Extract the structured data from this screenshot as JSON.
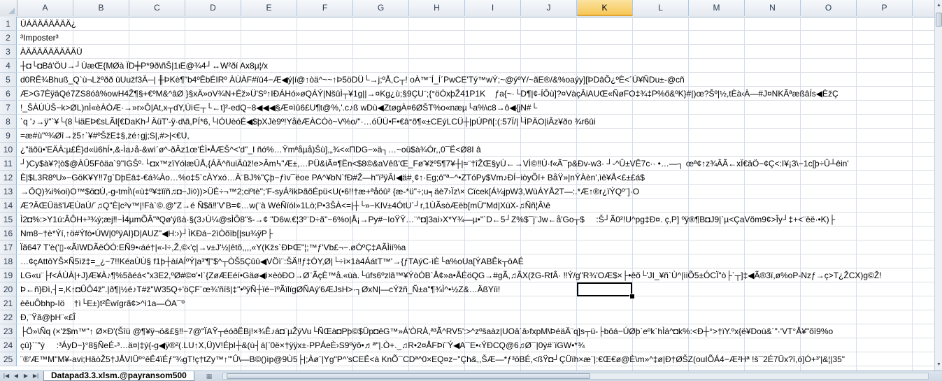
{
  "columns": [
    "A",
    "B",
    "C",
    "D",
    "E",
    "F",
    "G",
    "H",
    "I",
    "J",
    "K",
    "L",
    "M",
    "N",
    "O",
    "P"
  ],
  "active_column": "K",
  "rows": [
    {
      "n": "1",
      "text": "ÚÁÄÄÄÄÄÄÄ¿"
    },
    {
      "n": "2",
      "text": "³Imposter³"
    },
    {
      "n": "3",
      "text": "ÀÄÄÄÄÄÄÄÄÄÙ"
    },
    {
      "n": "4",
      "text": "┼◘└◘Bâ'ÖU→┘ÙæŒ{MØà ÏD╪P*9ð\\ñŠ|1ιE@¾4┘↔W²ðí Ax8μ¦/x"
    },
    {
      "n": "5",
      "text": "d0RÊ¾Bhuß_Q`ù¬Lžºðð ûUužf3Ä─| ╫ÞKè¶\"b4ºÊbÉIRº ÀÙÀF#ïû4−Æ◀ý|í@↑òä^~~↑Þ5öDÜ└→j;ºÅ,C┬! oÀ™¨Í_Í´PwCE'Tý™wÝ;~@ýºY/~ãE®/&%oaýy][ÞDâÕ¿ºÈ<´Ú¥ÑDu±-@cñ"
    },
    {
      "n": "6",
      "text": "Æ>G7ÈÿäQé7ZS8óâ%owH4Ž¶§+€ºM&^âØ }§xÄ»oV¾N+Éž»Ü'Sº↑IÐÁHó»øQÁÝ|NšûÌ┬¥1g||→¤Kg¿ù;§9ÇU¨;{°öÓxþŽ41P1K    ƒa{~·└D¶|¢-ÍÔù]?¤VàçÂiAUŒ«ÑøFO‡¾‡P%ő&ºK}#|)œ?Šº|½,tÈà‹À—#J¤NKÃªæßâÍs◀ÈžÇ"
    },
    {
      "n": "7",
      "text": "!_ŠÀÙÚŠ−k>ØL)nÌ«èÀÒÆ·→»r»Ô|At,x┬dY,Úi∈┬└←t]²-edQ−8◀◀◀§Æ¤ìû6£U¶t@%,'.c♪ß wDù◀ZtøgÀ¤6ØŠT%o«næµ└a%\\c8→ô◀{jN#└"
    },
    {
      "n": "8",
      "text": "`q '♪→ÿ\"`¥└(8└iäEÞ€sLÃI[€DaKh┘ÄüT'-ÿ·d\\ã,PÍ*6,└IÓUèóÉ◀$þXJè9º!YåêÆÀCÒò~V%o/\"·…óÛÙ•F•€â°õ¶«±CEýLCÜ┼|pÚPñ[:(:57Ï/|└ÌPÄO|iÂz¥ðo ¾r6ûi"
    },
    {
      "n": "9",
      "text": "=æ#ù\"º¾Øî→ž5↑`¥#ºŠžE‡§,zé↑gj;S|,#>|<€U,"
    },
    {
      "n": "10",
      "text": "¿\"äõü•'EÄÀ:µ£É}d«ü6hÍ•,&-Ìa♪å-&wì´ø^-ðÂz1œ'ÉÌ•ÅÆŠ^<'d\"_I ñó%…Ÿmªåµå)Šù],„¾<«ΠDG−»ä┐…~oü$à¾Ór,,0¯Ë<Ø8I â"
    },
    {
      "n": "11",
      "text": "┘)Cy$à¥?¦ò$@ÀÛ5Fôäa`9\"IGŠº·└◘x™zïYólæÜÅ,{ÁÄ^ñuiÄûž!e>Âm߆\"Æ±,…PÜ&iÃ¤¶Ën<$8©&aVêß'Œ_Fø'¥žº5¶7¥┼|≈¨†îŽŒ§yÙ←→VÌ©‼Ú·f«Ã¯p&Ðv-w3· ┘-^Û±VÊ7c·· •…—┐ œª¢↑z¾ÂÃ←xÏ€äÖ−¢Ç<:Ι¥¡3\\−1c[þ÷Û┴êin'"
    },
    {
      "n": "12",
      "text": "È|$L3R8ºU»−GöK¥Y‼7g`DþEâ‡-€á¾Ào…%o‡5`cÀYxó…Ä¨BJ%\"Çþ−ƒìv¯ëoe PA^¥bN`fÐ#Ž—h\"ï³ÿÂI◀ä#¸¢↑·Eg;ô\"ª−^•ZTóPy$Vm♪ÐÍ−iòyÕî+ BåŸ»|nÝÀèn',ìê¥Å<£±£á$"
    },
    {
      "n": "13",
      "text": "→ÖQ)¾i%oi)O™$ö◘Ù,-g▫tmÌ\\(«ù‡º¥‡ǐïñ♫◘−Ji◊))>ÜÉ÷¬™2;ciºtè\";'F-syÁ²ikÞãõÉpü<U(•6!!†æ+ªåöû² {æ-*ü\"÷;u╕äè7›Ïz\\× Cïcek[Á¼jpW3,WùÁYÅ2T—:.*Æ↑®r¿ïÝQº¨]·O"
    },
    {
      "n": "14",
      "text": "Æ?ÄŒÜäš'IÆÙaÚ/´♫Q\"È|c²v™|!Fà`©.@\"Z→é Ñ$ã‼'V'B=¢…w(¨à WéÑïóI»1Lò;P•3ŠÀ<=|┼└»−KI\\/±4ÓtU´┘r,1ÙÃsòÆëb[mÜ\"Md|XùX-♫Ññ¦Â\\ê"
    },
    {
      "n": "15",
      "text": "Ì2◘%:>Y1ú:ÂÔH+³¾ý;æj‼−Ì4µmÕÂ\"ªQø'ýßà·§(3♪Ù¼@sÌÔ8\"š-→¢ \"D6w.€¦3º¨D÷ã\"−6%o|Å¡→Py#−IoŸŸ…¨^◘]3aì›X*Y¾—µ•\"`D←5┘Z%$¯j¨Jw←å'Go┬$     :Š┘Ã0²!U^pg‡Ð¤. ç,P] ºÿ®¶B◘J9|`µ<ÇaVõm9¢>Îy┘‡+<¨ëë·•K)├"
    },
    {
      "n": "16",
      "text": "Nm8−†è*Ýí,↑ö#Ýfò•ÚW|0ºÿAI}D|AUZ\"◀H:›)┘ÌKÐá−2ìÒõïb[|su¾ÿP├"
    },
    {
      "n": "17",
      "text": "Ïã647 T'è('▯-«ÃïWDÃëÓÓ:EÑ9•‹áé†|«-Ι÷,Ž,©‹'ç|→v±J'½|êtõ,,,,«Y(Kžs`ÐÞŒ\"¦;™ƒ'Vb£¬−.øÓºÇ‡AÃÌií%a"
    },
    {
      "n": "18",
      "text": "…¢çAttôYŠ×Ñ5ìž‡=_¿−7!!KéaÙÙ§ f1þ┼àíAÍºÝ|a³'¶\"$^┬ÒŠ5Çûû◀VÖì¨:ŠÄ‼ƒ‡ÓY,Ø|└÷ì×1à4ÁátT™'→{ƒTAýC·ìÈ└a%oUa[ÝABÊk┬ôAÉ"
    },
    {
      "n": "19",
      "text": "LG«u¨├f<ÁÙÀ|+J}Æ¥À♪¶%5âéá<\"x3E2,ºØ#©¤'•I`{ZøÆEéí•Gäø◀ì×èòÐO→Ø¨ÃçÈ™å.«ùà.└úfs6ºzlã™¥ÝòÓB`Å¢»a•ÅÉöQG→#gÃ,♫ÂX(ž̌G-RfÂ· ‼Ý/g\"R¾'OÆ$×├•êõ└'JI_¥ñ`Ù^|ìiÕ5±ÓCÏ\"ò├`┬]‡◀Ã®3ï,ø%oP-Nzƒ→ç>T¿ŽCX)g©Ž!"
    },
    {
      "n": "20",
      "text": "Þ←ñ}Ðì,┤=,K↑◘ÛÔ4ž\".|ð¶|½é♪T#ž\"W35Q+'öÇF¨œ¾'ñïš|‡\"•ºÿÑ┼ïé−îºÃïlïgØÑAý'6ÆJsH>·┐ØxN|—cÝžñ_Ñ±a\"¶¾Ì^•½Z&…ÄßYïi!"
    },
    {
      "n": "21",
      "text": "èêuÔbhp-Ιö    †ì└E±)t²Ēwîgrã¢>^ì1a—ÓA¯º"
    },
    {
      "n": "22",
      "text": "Ð,¨Ÿã@þH¨«£Î"
    },
    {
      "n": "23",
      "text": "├Ö»\\Ñq (×'ž$m™\"↑ Ø×Ð'(Šîü @¶¥ÿ¬ö&£§‼−7@\"ÏAŸ┬éóðËBj!×¾Ê♪á◘¨µŽýVu└ÑŒà◘Pþ©$Üp◘êG™»Á'ÒRÀ,ª³Ã^RV5':>^zºšaàz|UOâ´â›fxpM\\ÞéäÄ¨q]s┬ü-├bôá−ÚØþ`eºk`hÌá^◘k%:<Ð┼°>†ïY.ºx{ë¥Doù&´\"·'VT°Å¥\"õï9%o"
    },
    {
      "n": "24",
      "text": "çû}`¨\"ý     :³ÁyD−}°8§ÑeÉ-³…ä¤|‡ý{-g◀ÿ®²(.LU↑X,Ü)V!ÉþI┼&(ù┤á|¨0ë×†ÿÿx±·PPÁeÈ›S9ºýõ•♬ª\"|.Ò+._♫R•2¤ÅFÞï¨Ý◀A¯E•‹ÝÐCQ@6♫Ø¯|0ý#¨ïGW•*¾"
    },
    {
      "n": "25",
      "text": "¨®'Æ™M\"M¥-avi;HâòŽ5†JÅVIÜº°êÊ4ïÉƒ\"¾gT!ç†tZy™↑'\"Û\\—B©()ìp@9Ù5├|;Àø¨|Yg\"P^'sCEË<à KnÕ¯CDª^0×EQ¤z−\"Çh&,,ŠÆ—*ƒ³ôBÉ,<ßŸ◘┘ÇÜïh×æ¨|:€Œ€ø@È\\m»^‡ø|Ð†ØŠZ(ouIÕÁ4−Æ²Hª !š¯2É7Üx?î,ö]Ó+³'|&¦|35\""
    }
  ],
  "sheet_tab": {
    "label": "Datapad3.3.xlsm.@payransom500"
  }
}
